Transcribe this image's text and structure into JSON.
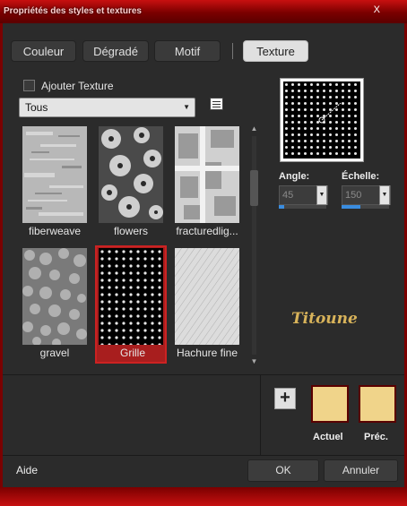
{
  "window": {
    "title": "Propriétés des styles et textures",
    "close_label": "X"
  },
  "tabs": [
    {
      "label": "Couleur"
    },
    {
      "label": "Dégradé"
    },
    {
      "label": "Motif"
    },
    {
      "label": "Texture",
      "active": true
    }
  ],
  "texture": {
    "add_label": "Ajouter Texture",
    "category": "Tous",
    "thumbnails": [
      {
        "label": "fiberweave"
      },
      {
        "label": "flowers"
      },
      {
        "label": "fracturedlig..."
      },
      {
        "label": "gravel"
      },
      {
        "label": "Grille",
        "selected": true
      },
      {
        "label": "Hachure fine"
      }
    ]
  },
  "angle": {
    "label": "Angle:",
    "value": "45",
    "level_fraction": 0.12
  },
  "scale": {
    "label": "Échelle:",
    "value": "150",
    "level_fraction": 0.4
  },
  "signature": "Titoune",
  "colors": {
    "current_label": "Actuel",
    "previous_label": "Préc.",
    "current_hex": "#f0d48a",
    "previous_hex": "#f0d48a"
  },
  "footer": {
    "help": "Aide",
    "ok": "OK",
    "cancel": "Annuler"
  }
}
